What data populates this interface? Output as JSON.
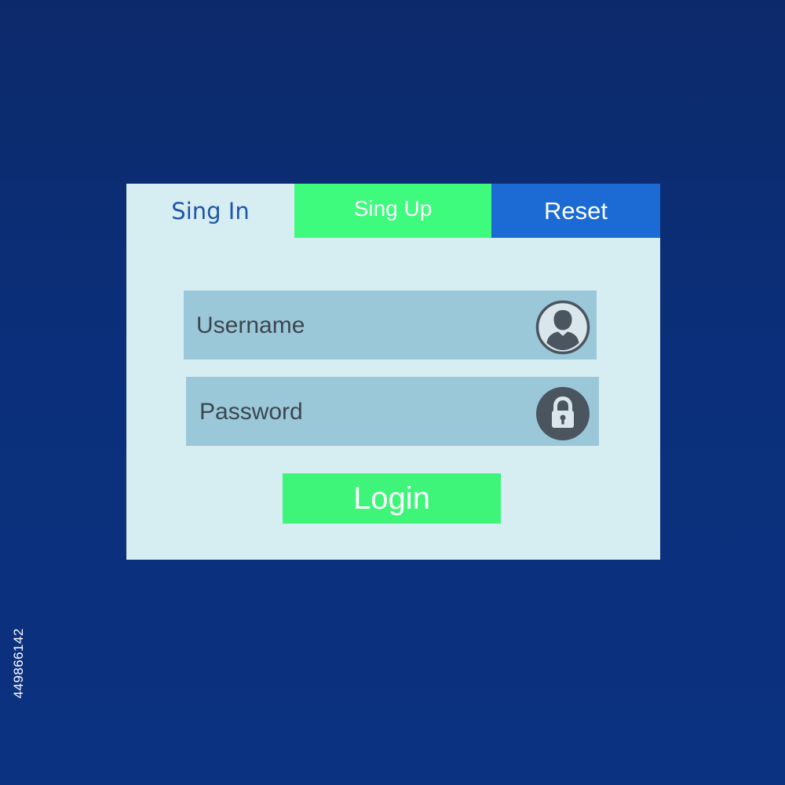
{
  "tabs": {
    "signin_label": "Sing In",
    "signup_label": "Sing Up",
    "reset_label": "Reset"
  },
  "form": {
    "username_placeholder": "Username",
    "password_placeholder": "Password",
    "login_label": "Login"
  },
  "icons": {
    "username": "user-icon",
    "password": "lock-icon"
  },
  "stock_id": "449866142",
  "colors": {
    "background": "#0c2c72",
    "panel": "#d6eef2",
    "signup_tab": "#3efb7e",
    "reset_tab": "#1c6ad4",
    "signin_text": "#1f56a8",
    "field": "#9bc8d8",
    "icon": "#4a555f",
    "login_button": "#3ef57a"
  }
}
